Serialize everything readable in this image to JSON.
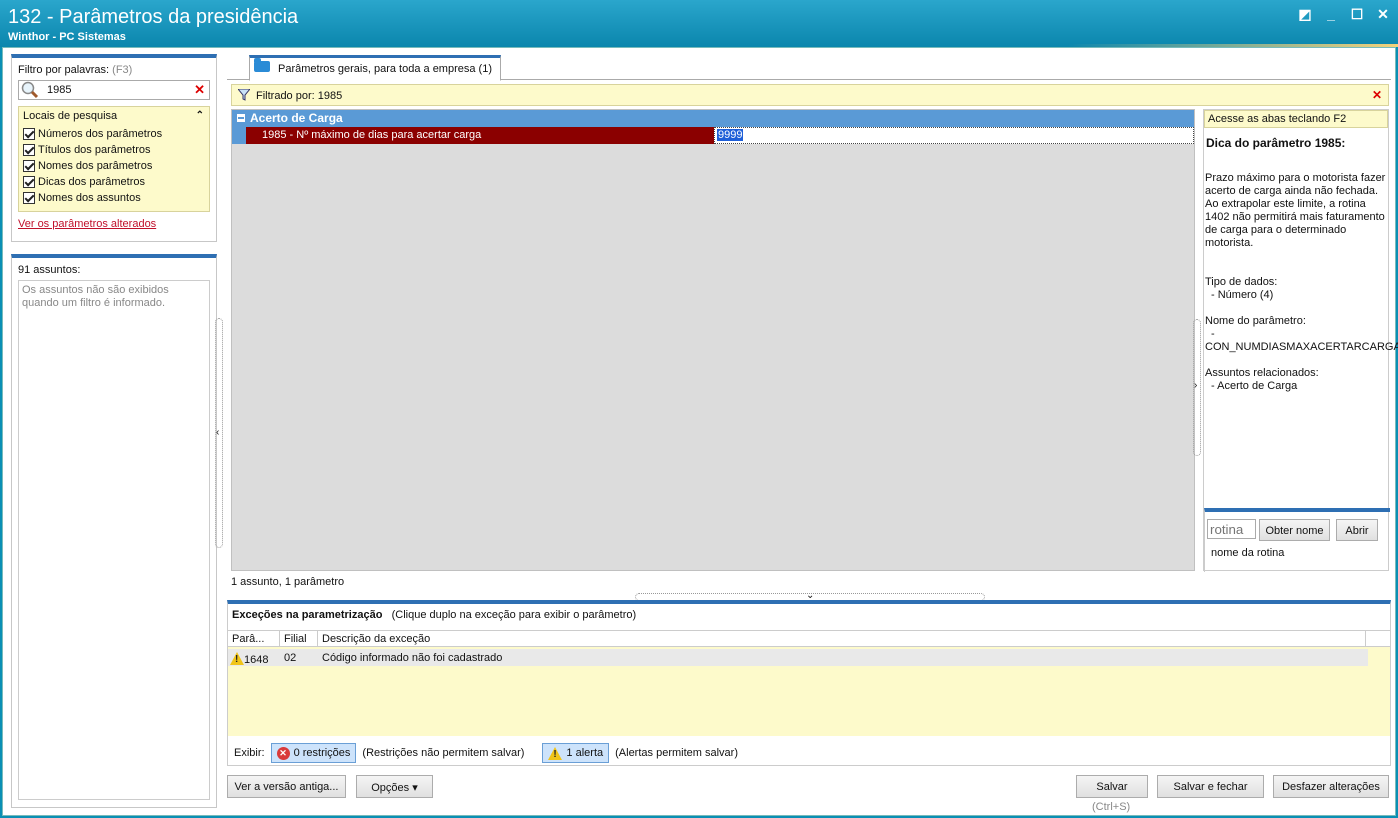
{
  "window": {
    "title": "132 - Parâmetros da presidência",
    "subtitle": "Winthor - PC Sistemas"
  },
  "filter": {
    "label": "Filtro por palavras:",
    "shortcut": "(F3)",
    "value": "1985",
    "locais_title": "Locais de pesquisa",
    "options": [
      "Números dos parâmetros",
      "Títulos dos parâmetros",
      "Nomes dos parâmetros",
      "Dicas dos parâmetros",
      "Nomes dos assuntos"
    ],
    "link": "Ver os parâmetros alterados"
  },
  "assuntos": {
    "count_label": "91 assuntos:",
    "message": "Os assuntos não são exibidos quando um filtro é informado."
  },
  "tab": {
    "label": "Parâmetros gerais, para toda a empresa  (1)"
  },
  "filtered": {
    "label": "Filtrado por: 1985"
  },
  "grid": {
    "group": "Acerto de Carga",
    "param_name": "1985 - Nº máximo de dias para acertar carga",
    "param_value": "9999",
    "count": "1 assunto, 1 parâmetro"
  },
  "help": {
    "shortcut_hint": "Acesse as abas teclando F2",
    "tip_title": "Dica do parâmetro 1985:",
    "description": "Prazo máximo para o motorista fazer acerto de carga ainda não fechada. Ao extrapolar este limite, a rotina 1402 não permitirá mais faturamento de carga para o determinado motorista.",
    "tipo_label": "Tipo de dados:",
    "tipo_value": "- Número (4)",
    "nome_label": "Nome do parâmetro:",
    "nome_dash": "-",
    "nome_value": "CON_NUMDIASMAXACERTARCARGA",
    "assuntos_label": "Assuntos relacionados:",
    "assuntos_value": "- Acerto de Carga",
    "rotina_placeholder": "rotina",
    "obter_nome": "Obter nome",
    "abrir": "Abrir",
    "rotina_nome": "nome da rotina"
  },
  "exceptions": {
    "title": "Exceções na parametrização",
    "hint": "(Clique duplo na exceção para exibir o parâmetro)",
    "columns": [
      "Parâ...",
      "Filial",
      "Descrição da exceção"
    ],
    "rows": [
      {
        "param": "1648",
        "filial": "02",
        "descricao": "Código informado não foi cadastrado"
      }
    ],
    "exibir": "Exibir:",
    "restricoes": "0 restrições",
    "restricoes_note": "(Restrições não permitem salvar)",
    "alertas": "1 alerta",
    "alertas_note": "(Alertas permitem salvar)"
  },
  "buttons": {
    "versao_antiga": "Ver a versão antiga...",
    "opcoes": "Opções ▾",
    "salvar": "Salvar",
    "salvar_shortcut": "(Ctrl+S)",
    "salvar_fechar": "Salvar e fechar",
    "desfazer": "Desfazer alterações"
  },
  "colors": {
    "titlebar": "#0b86ad",
    "selected_row": "#8b0000",
    "group_header": "#5a9ad6",
    "accent": "#2e6fb3"
  }
}
